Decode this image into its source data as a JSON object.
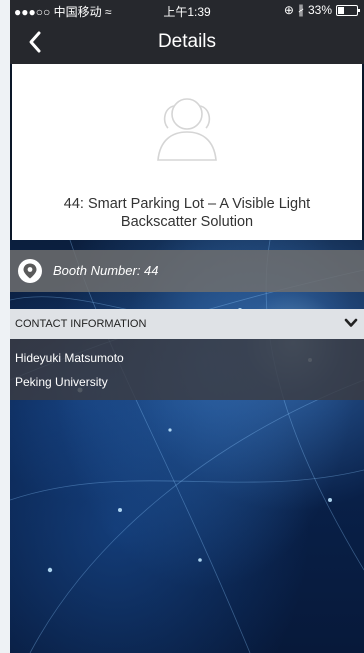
{
  "status_bar": {
    "carrier": "●●●○○ 中国移动 ≈",
    "time": "上午1:39",
    "battery": "33%",
    "battery_level": 0.33,
    "icons": [
      "lock-rotation-icon",
      "bluetooth-icon",
      "battery-icon"
    ]
  },
  "nav": {
    "title": "Details",
    "back_icon": "chevron-left-icon"
  },
  "card": {
    "avatar_icon": "user-placeholder-icon",
    "title": "44: Smart Parking Lot – A Visible Light Backscatter Solution"
  },
  "booth": {
    "icon": "map-pin-icon",
    "label": "Booth Number: 44"
  },
  "contact": {
    "header": "CONTACT INFORMATION",
    "toggle_icon": "chevron-down-icon",
    "name": "Hideyuki Matsumoto",
    "organization": "Peking University"
  },
  "colors": {
    "bar": "#26282d",
    "card": "#ffffff",
    "contact_header": "#dfe2e6"
  }
}
